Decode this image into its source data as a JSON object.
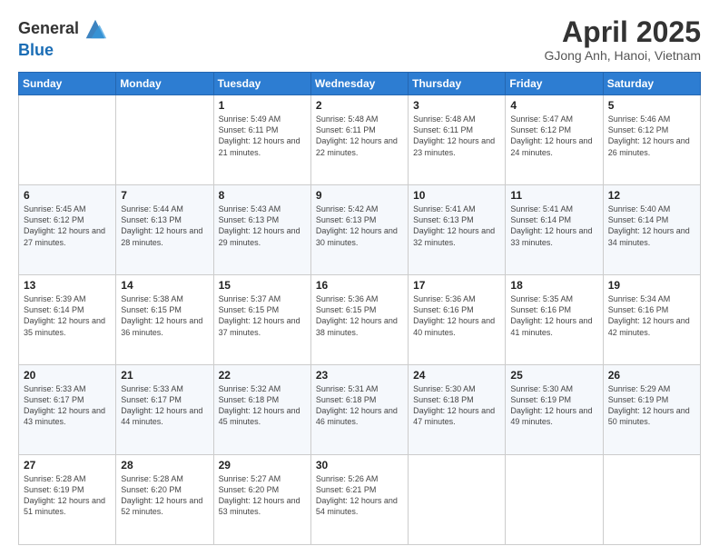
{
  "header": {
    "logo_line1": "General",
    "logo_line2": "Blue",
    "month_title": "April 2025",
    "subtitle": "GJong Anh, Hanoi, Vietnam"
  },
  "weekdays": [
    "Sunday",
    "Monday",
    "Tuesday",
    "Wednesday",
    "Thursday",
    "Friday",
    "Saturday"
  ],
  "weeks": [
    [
      {
        "day": "",
        "sunrise": "",
        "sunset": "",
        "daylight": ""
      },
      {
        "day": "",
        "sunrise": "",
        "sunset": "",
        "daylight": ""
      },
      {
        "day": "1",
        "sunrise": "Sunrise: 5:49 AM",
        "sunset": "Sunset: 6:11 PM",
        "daylight": "Daylight: 12 hours and 21 minutes."
      },
      {
        "day": "2",
        "sunrise": "Sunrise: 5:48 AM",
        "sunset": "Sunset: 6:11 PM",
        "daylight": "Daylight: 12 hours and 22 minutes."
      },
      {
        "day": "3",
        "sunrise": "Sunrise: 5:48 AM",
        "sunset": "Sunset: 6:11 PM",
        "daylight": "Daylight: 12 hours and 23 minutes."
      },
      {
        "day": "4",
        "sunrise": "Sunrise: 5:47 AM",
        "sunset": "Sunset: 6:12 PM",
        "daylight": "Daylight: 12 hours and 24 minutes."
      },
      {
        "day": "5",
        "sunrise": "Sunrise: 5:46 AM",
        "sunset": "Sunset: 6:12 PM",
        "daylight": "Daylight: 12 hours and 26 minutes."
      }
    ],
    [
      {
        "day": "6",
        "sunrise": "Sunrise: 5:45 AM",
        "sunset": "Sunset: 6:12 PM",
        "daylight": "Daylight: 12 hours and 27 minutes."
      },
      {
        "day": "7",
        "sunrise": "Sunrise: 5:44 AM",
        "sunset": "Sunset: 6:13 PM",
        "daylight": "Daylight: 12 hours and 28 minutes."
      },
      {
        "day": "8",
        "sunrise": "Sunrise: 5:43 AM",
        "sunset": "Sunset: 6:13 PM",
        "daylight": "Daylight: 12 hours and 29 minutes."
      },
      {
        "day": "9",
        "sunrise": "Sunrise: 5:42 AM",
        "sunset": "Sunset: 6:13 PM",
        "daylight": "Daylight: 12 hours and 30 minutes."
      },
      {
        "day": "10",
        "sunrise": "Sunrise: 5:41 AM",
        "sunset": "Sunset: 6:13 PM",
        "daylight": "Daylight: 12 hours and 32 minutes."
      },
      {
        "day": "11",
        "sunrise": "Sunrise: 5:41 AM",
        "sunset": "Sunset: 6:14 PM",
        "daylight": "Daylight: 12 hours and 33 minutes."
      },
      {
        "day": "12",
        "sunrise": "Sunrise: 5:40 AM",
        "sunset": "Sunset: 6:14 PM",
        "daylight": "Daylight: 12 hours and 34 minutes."
      }
    ],
    [
      {
        "day": "13",
        "sunrise": "Sunrise: 5:39 AM",
        "sunset": "Sunset: 6:14 PM",
        "daylight": "Daylight: 12 hours and 35 minutes."
      },
      {
        "day": "14",
        "sunrise": "Sunrise: 5:38 AM",
        "sunset": "Sunset: 6:15 PM",
        "daylight": "Daylight: 12 hours and 36 minutes."
      },
      {
        "day": "15",
        "sunrise": "Sunrise: 5:37 AM",
        "sunset": "Sunset: 6:15 PM",
        "daylight": "Daylight: 12 hours and 37 minutes."
      },
      {
        "day": "16",
        "sunrise": "Sunrise: 5:36 AM",
        "sunset": "Sunset: 6:15 PM",
        "daylight": "Daylight: 12 hours and 38 minutes."
      },
      {
        "day": "17",
        "sunrise": "Sunrise: 5:36 AM",
        "sunset": "Sunset: 6:16 PM",
        "daylight": "Daylight: 12 hours and 40 minutes."
      },
      {
        "day": "18",
        "sunrise": "Sunrise: 5:35 AM",
        "sunset": "Sunset: 6:16 PM",
        "daylight": "Daylight: 12 hours and 41 minutes."
      },
      {
        "day": "19",
        "sunrise": "Sunrise: 5:34 AM",
        "sunset": "Sunset: 6:16 PM",
        "daylight": "Daylight: 12 hours and 42 minutes."
      }
    ],
    [
      {
        "day": "20",
        "sunrise": "Sunrise: 5:33 AM",
        "sunset": "Sunset: 6:17 PM",
        "daylight": "Daylight: 12 hours and 43 minutes."
      },
      {
        "day": "21",
        "sunrise": "Sunrise: 5:33 AM",
        "sunset": "Sunset: 6:17 PM",
        "daylight": "Daylight: 12 hours and 44 minutes."
      },
      {
        "day": "22",
        "sunrise": "Sunrise: 5:32 AM",
        "sunset": "Sunset: 6:18 PM",
        "daylight": "Daylight: 12 hours and 45 minutes."
      },
      {
        "day": "23",
        "sunrise": "Sunrise: 5:31 AM",
        "sunset": "Sunset: 6:18 PM",
        "daylight": "Daylight: 12 hours and 46 minutes."
      },
      {
        "day": "24",
        "sunrise": "Sunrise: 5:30 AM",
        "sunset": "Sunset: 6:18 PM",
        "daylight": "Daylight: 12 hours and 47 minutes."
      },
      {
        "day": "25",
        "sunrise": "Sunrise: 5:30 AM",
        "sunset": "Sunset: 6:19 PM",
        "daylight": "Daylight: 12 hours and 49 minutes."
      },
      {
        "day": "26",
        "sunrise": "Sunrise: 5:29 AM",
        "sunset": "Sunset: 6:19 PM",
        "daylight": "Daylight: 12 hours and 50 minutes."
      }
    ],
    [
      {
        "day": "27",
        "sunrise": "Sunrise: 5:28 AM",
        "sunset": "Sunset: 6:19 PM",
        "daylight": "Daylight: 12 hours and 51 minutes."
      },
      {
        "day": "28",
        "sunrise": "Sunrise: 5:28 AM",
        "sunset": "Sunset: 6:20 PM",
        "daylight": "Daylight: 12 hours and 52 minutes."
      },
      {
        "day": "29",
        "sunrise": "Sunrise: 5:27 AM",
        "sunset": "Sunset: 6:20 PM",
        "daylight": "Daylight: 12 hours and 53 minutes."
      },
      {
        "day": "30",
        "sunrise": "Sunrise: 5:26 AM",
        "sunset": "Sunset: 6:21 PM",
        "daylight": "Daylight: 12 hours and 54 minutes."
      },
      {
        "day": "",
        "sunrise": "",
        "sunset": "",
        "daylight": ""
      },
      {
        "day": "",
        "sunrise": "",
        "sunset": "",
        "daylight": ""
      },
      {
        "day": "",
        "sunrise": "",
        "sunset": "",
        "daylight": ""
      }
    ]
  ]
}
